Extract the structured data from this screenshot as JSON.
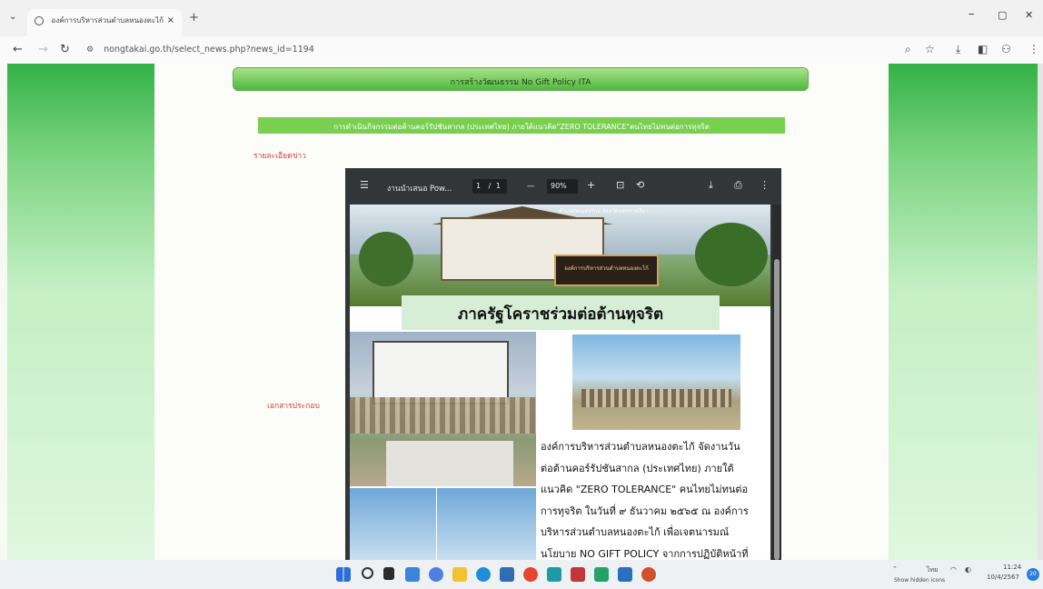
{
  "browser": {
    "tab_title": "องค์การบริหารส่วนตำบลหนองตะไก้",
    "new_tab": "+",
    "tab_close": "×",
    "minimize": "–",
    "restore": "▢",
    "close": "✕",
    "url_site_icon": "⚙",
    "url": "nongtakai.go.th/select_news.php?news_id=1194"
  },
  "page": {
    "title": "การสร้างวัฒนธรรม No Gift Policy ITA",
    "subtitle": "การดำเนินกิจกรรมต่อต้านคอร์รัปชันสากล (ประเทศไทย) ภายใต้แนวคิด\"ZERO TOLERANCE\"คนไทยไม่ทนต่อการทุจริต",
    "details_label": "รายละเอียดข่าว",
    "attachments_label": "เอกสารประกอบ"
  },
  "pdf_viewer": {
    "doc_title": "งานนำเสนอ Pow...",
    "page_current": "1",
    "page_sep": "/",
    "page_total": "1",
    "zoom_minus": "—",
    "zoom": "90%",
    "zoom_plus": "+",
    "banner_text": "อำเภอพนมดงรักษ์ จังหวัดนครราชสีมา",
    "sign_text": "องค์การบริหารส่วนตำบลหนองตะไก้",
    "headline": "ภาครัฐโคราชร่วมต่อต้านทุจริต",
    "article_lines": [
      "องค์การบริหารส่วนตำบลหนองตะไก้ จัดงานวัน",
      "ต่อต้านคอร์รัปชันสากล (ประเทศไทย) ภายใต้",
      "แนวคิด \"ZERO TOLERANCE\" คนไทยไม่ทนต่อ",
      "การทุจริต ในวันที่ ๙ ธันวาคม ๒๕๖๕ ณ องค์การ",
      "บริหารส่วนตำบลหนองตะไก้ เพื่อเจตนารมณ์",
      "นโยบาย NO GIFT POLICY จากการปฏิบัติหน้าที่"
    ]
  },
  "taskbar": {
    "tray_label": "Show hidden icons",
    "lang": "ไทย",
    "time": "11:24",
    "date": "10/4/2567",
    "notif_count": "20"
  },
  "colors": {
    "accent_green": "#4fb83e",
    "label_red": "#d0424a",
    "viewer_bg": "#323639"
  }
}
